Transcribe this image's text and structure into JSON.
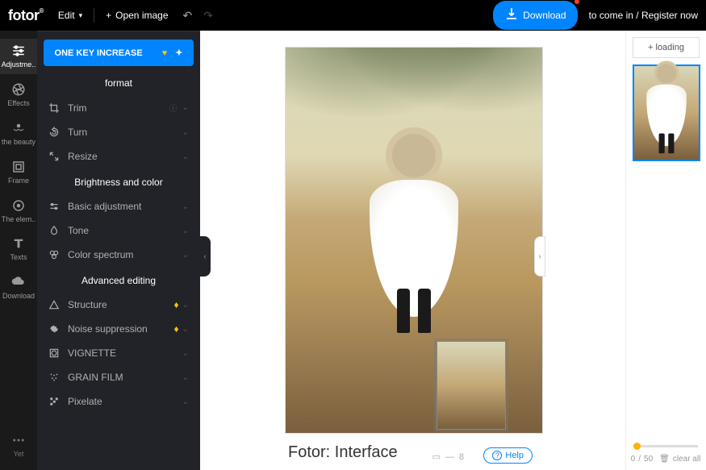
{
  "topbar": {
    "logo": "fotor",
    "edit": "Edit",
    "open_image": "Open image",
    "download": "Download",
    "auth_text": "to come in / Register now"
  },
  "rail": {
    "items": [
      {
        "label": "Adjustme..",
        "icon": "sliders"
      },
      {
        "label": "Effects",
        "icon": "aperture"
      },
      {
        "label": "the beauty",
        "icon": "sparkle"
      },
      {
        "label": "Frame",
        "icon": "frame"
      },
      {
        "label": "The elem..",
        "icon": "star"
      },
      {
        "label": "Texts",
        "icon": "text"
      },
      {
        "label": "Download",
        "icon": "cloud"
      }
    ],
    "yet": "Yet"
  },
  "panel": {
    "one_key": "ONE KEY INCREASE",
    "sections": [
      {
        "title": "format",
        "tools": [
          {
            "label": "Trim",
            "icon": "crop",
            "info": true
          },
          {
            "label": "Turn",
            "icon": "rotate"
          },
          {
            "label": "Resize",
            "icon": "arrows"
          }
        ]
      },
      {
        "title": "Brightness and color",
        "tools": [
          {
            "label": "Basic adjustment",
            "icon": "equalizer"
          },
          {
            "label": "Tone",
            "icon": "drop"
          },
          {
            "label": "Color spectrum",
            "icon": "palette"
          }
        ]
      },
      {
        "title": "Advanced editing",
        "tools": [
          {
            "label": "Structure",
            "icon": "triangle",
            "premium": true
          },
          {
            "label": "Noise suppression",
            "icon": "noise",
            "premium": true
          },
          {
            "label": "VIGNETTE",
            "icon": "vignette"
          },
          {
            "label": "GRAIN FILM",
            "icon": "grain"
          },
          {
            "label": "Pixelate",
            "icon": "pixel"
          }
        ]
      }
    ]
  },
  "canvas": {
    "caption": "Fotor: Interface",
    "zoom_value": "8",
    "help": "Help"
  },
  "right": {
    "loading": "loading",
    "history_value": "0",
    "history_max": "50",
    "clear_all": "clear all"
  }
}
